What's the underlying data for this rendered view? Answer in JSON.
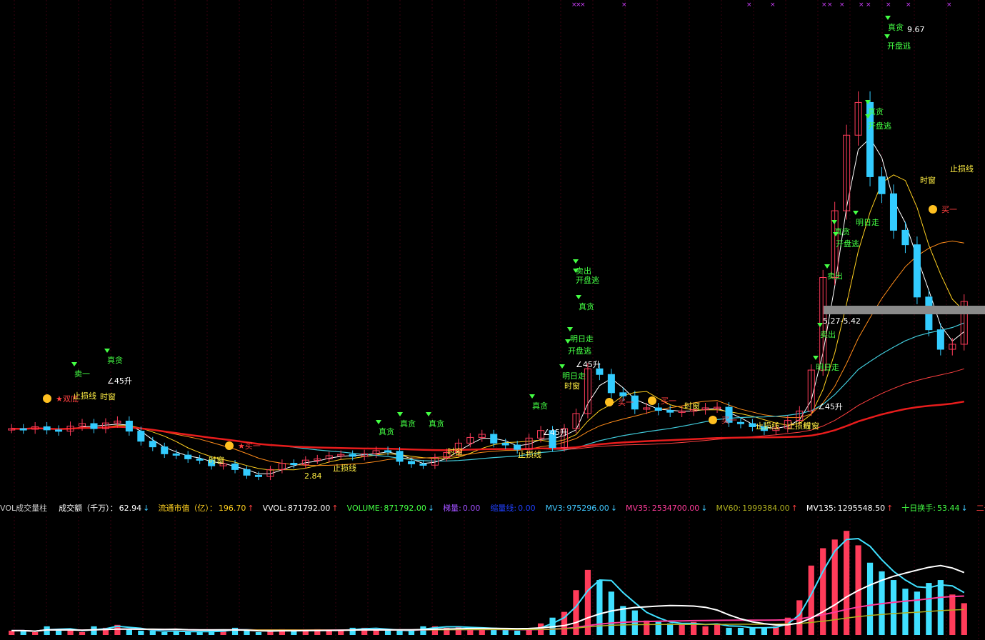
{
  "colors": {
    "background": "#000000",
    "up": "#ff3c5a",
    "down": "#33ccff",
    "ma_short": "#ffffff",
    "ma_mid": "#ffd020",
    "ma_orange": "#ff8c1a",
    "ma_cyan": "#40c8d8",
    "ma_red_thin": "#ff4040",
    "ma_red_thick": "#e81c1c",
    "buy_sig": "#ff4040",
    "sell_sig": "#44ff44",
    "label_yellow": "#ffee44",
    "label_white": "#ffffff",
    "marker_magenta": "#d040ff",
    "vol_teal": "#40e0ff",
    "vol_pink": "#ff3c9a",
    "vol_olive": "#b0b020",
    "vol_white": "#ffffff"
  },
  "chart_data": {
    "type": "candlestick",
    "price_series": [
      3.62,
      3.61,
      3.65,
      3.6,
      3.58,
      3.66,
      3.7,
      3.62,
      3.71,
      3.74,
      3.58,
      3.42,
      3.33,
      3.22,
      3.2,
      3.14,
      3.12,
      3.03,
      3.06,
      2.97,
      2.88,
      2.86,
      2.97,
      3.07,
      3.05,
      3.12,
      3.14,
      3.19,
      3.21,
      3.18,
      3.22,
      3.27,
      3.26,
      3.1,
      3.06,
      3.04,
      3.16,
      3.24,
      3.39,
      3.48,
      3.53,
      3.39,
      3.36,
      3.29,
      3.47,
      3.59,
      3.32,
      3.62,
      3.86,
      4.57,
      4.48,
      4.19,
      4.14,
      3.93,
      3.95,
      3.91,
      3.88,
      3.9,
      3.92,
      3.95,
      3.96,
      3.72,
      3.7,
      3.65,
      3.59,
      3.63,
      3.75,
      3.9,
      4.55,
      6.02,
      7.08,
      8.28,
      8.8,
      7.62,
      7.35,
      6.77,
      6.54,
      5.71,
      5.19,
      4.88,
      4.96,
      5.64
    ],
    "volume_series": [
      3,
      3,
      2,
      6,
      4,
      3,
      2,
      6,
      5,
      7,
      4,
      3,
      3,
      2,
      3,
      2,
      2,
      3,
      3,
      5,
      3,
      2,
      3,
      4,
      3,
      3,
      4,
      3,
      3,
      5,
      5,
      4,
      3,
      3,
      3,
      6,
      6,
      5,
      6,
      5,
      4,
      5,
      4,
      3,
      4,
      8,
      12,
      16,
      31,
      45,
      38,
      30,
      20,
      17,
      10,
      9,
      8,
      7,
      9,
      6,
      8,
      5,
      5,
      5,
      5,
      6,
      12,
      24,
      48,
      60,
      66,
      72,
      62,
      50,
      44,
      38,
      32,
      30,
      36,
      38,
      28,
      22
    ],
    "signals": [
      {
        "label": "卖一",
        "kind": "sell"
      },
      {
        "label": "真贪",
        "kind": "sell"
      },
      {
        "label": "∠45升",
        "kind": "star"
      },
      {
        "label": "★双底",
        "kind": "buy"
      },
      {
        "label": "止损线",
        "kind": "line"
      },
      {
        "label": "时窗",
        "kind": "time"
      },
      {
        "label": "时窗",
        "kind": "time"
      },
      {
        "label": "★买一",
        "kind": "buy"
      },
      {
        "label": "2.84",
        "kind": "low"
      },
      {
        "label": "止损线",
        "kind": "line"
      },
      {
        "label": "真贪",
        "kind": "sell"
      },
      {
        "label": "真贪",
        "kind": "sell"
      },
      {
        "label": "真贪",
        "kind": "sell"
      },
      {
        "label": "时窗",
        "kind": "time"
      },
      {
        "label": "止损线",
        "kind": "line"
      },
      {
        "label": "真贪",
        "kind": "sell"
      },
      {
        "label": "∠45升",
        "kind": "star"
      },
      {
        "label": "卖出",
        "kind": "sell"
      },
      {
        "label": "开盘逃",
        "kind": "sell"
      },
      {
        "label": "真贪",
        "kind": "sell"
      },
      {
        "label": "明日走",
        "kind": "sell"
      },
      {
        "label": "开盘逃",
        "kind": "sell"
      },
      {
        "label": "∠45升",
        "kind": "star"
      },
      {
        "label": "明日走",
        "kind": "sell"
      },
      {
        "label": "时窗",
        "kind": "time"
      },
      {
        "label": "买一",
        "kind": "buy"
      },
      {
        "label": "买一",
        "kind": "buy"
      },
      {
        "label": "时窗",
        "kind": "time"
      },
      {
        "label": "买一",
        "kind": "buy"
      },
      {
        "label": "止损线",
        "kind": "line"
      },
      {
        "label": "止损线",
        "kind": "line"
      },
      {
        "label": "时窗",
        "kind": "time"
      },
      {
        "label": "∠45升",
        "kind": "star"
      },
      {
        "label": "卖出",
        "kind": "sell"
      },
      {
        "label": "5.27-5.42",
        "kind": "range"
      },
      {
        "label": "明日走",
        "kind": "sell"
      },
      {
        "label": "卖出",
        "kind": "sell"
      },
      {
        "label": "真贪",
        "kind": "sell"
      },
      {
        "label": "开盘逃",
        "kind": "sell"
      },
      {
        "label": "明日走",
        "kind": "sell"
      },
      {
        "label": "真贪",
        "kind": "sell"
      },
      {
        "label": "开盘逃",
        "kind": "sell"
      },
      {
        "label": "真贪",
        "kind": "sell"
      },
      {
        "label": "9.67",
        "kind": "high"
      },
      {
        "label": "开盘逃",
        "kind": "sell"
      },
      {
        "label": "时窗",
        "kind": "time"
      },
      {
        "label": "买一",
        "kind": "buy"
      },
      {
        "label": "止损线",
        "kind": "line"
      }
    ],
    "indicators": [
      {
        "label": "VOL成交量柱",
        "value": ""
      },
      {
        "label": "成交额（千万）：",
        "value": "62.94",
        "arrow": "↓"
      },
      {
        "label": "流通市值（亿）：",
        "value": "196.70",
        "arrow": "↑"
      },
      {
        "label": "VVOL: ",
        "value": "871792.00",
        "arrow": "↑"
      },
      {
        "label": "VOLUME: ",
        "value": "871792.00",
        "arrow": "↓"
      },
      {
        "label": "梯量: ",
        "value": "0.00",
        "arrow": ""
      },
      {
        "label": "缩量线: ",
        "value": "0.00",
        "arrow": ""
      },
      {
        "label": "MV3: ",
        "value": "975296.00",
        "arrow": "↓"
      },
      {
        "label": "MV35: ",
        "value": "2534700.00",
        "arrow": "↓"
      },
      {
        "label": "MV60: ",
        "value": "1999384.00",
        "arrow": "↑"
      },
      {
        "label": "MV135: ",
        "value": "1295548.50",
        "arrow": "↑"
      },
      {
        "label": "十日换手: ",
        "value": "53.44",
        "arrow": "↓"
      },
      {
        "label": "二十日",
        "value": "",
        "arrow": ""
      }
    ],
    "indicator_colors": [
      "#cccccc",
      "#ffffff",
      "#ffd020",
      "#ffffff",
      "#44ff44",
      "#a050ff",
      "#2040ff",
      "#40c8ff",
      "#ff3c9a",
      "#b0b020",
      "#ffffff",
      "#44ff44",
      "#ff4040"
    ],
    "grid": true,
    "legend": "top-left"
  }
}
